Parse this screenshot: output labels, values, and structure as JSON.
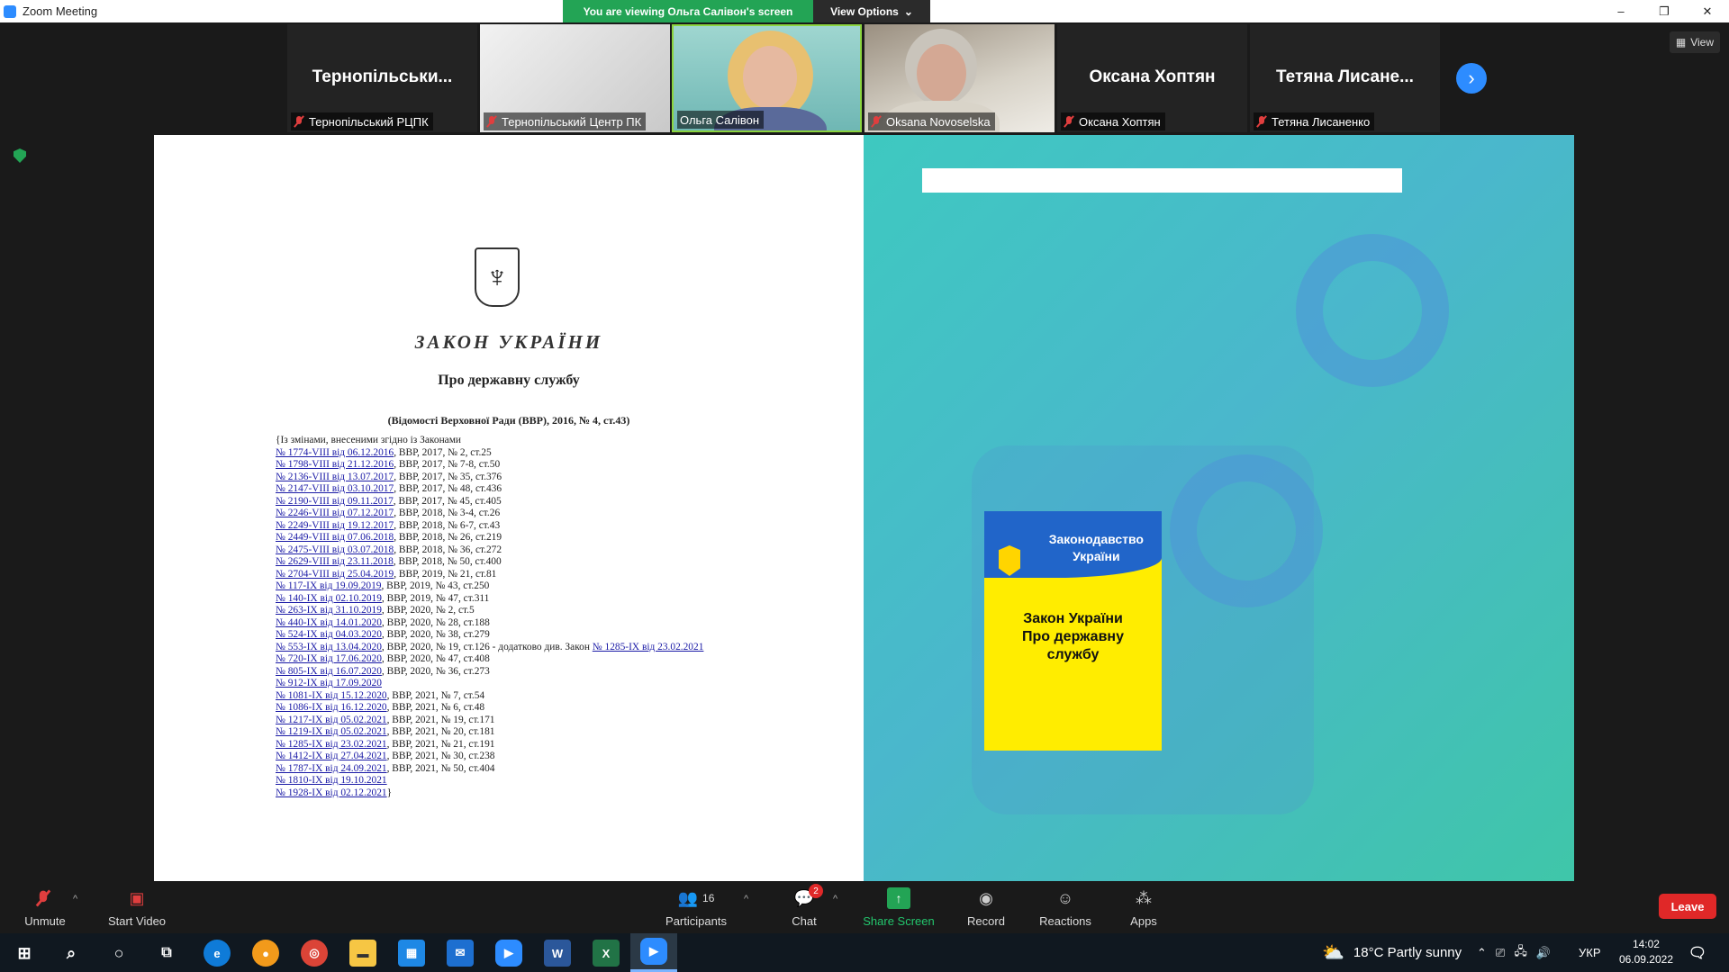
{
  "window": {
    "title": "Zoom Meeting",
    "banner": "You are viewing Ольга Салівон's screen",
    "view_options": "View Options",
    "controls": [
      "–",
      "❐",
      "✕"
    ]
  },
  "strip": {
    "tiles": [
      {
        "big_name": "Тернопільськи...",
        "label": "Тернопільський РЦПК"
      },
      {
        "big_name": "",
        "label": "Тернопільський Центр ПК"
      },
      {
        "big_name": "",
        "label": "Ольга Салівон"
      },
      {
        "big_name": "",
        "label": "Oksana Novoselska"
      },
      {
        "big_name": "Оксана Хоптян",
        "label": "Оксана Хоптян"
      },
      {
        "big_name": "Тетяна  Лисане...",
        "label": "Тетяна Лисаненко"
      }
    ],
    "view_label": "View"
  },
  "document": {
    "title": "ЗАКОН УКРАЇНИ",
    "subtitle": "Про державну службу",
    "source": "(Відомості Верховної Ради (ВВР), 2016, № 4, ст.43)",
    "intro": "{Із змінами, внесеними згідно із Законами",
    "amendments": [
      {
        "link": "№ 1774-VIII від 06.12.2016",
        "ref": ", ВВР, 2017, № 2, ст.25"
      },
      {
        "link": "№ 1798-VIII від 21.12.2016",
        "ref": ", ВВР, 2017, № 7-8, ст.50"
      },
      {
        "link": "№ 2136-VIII від 13.07.2017",
        "ref": ", ВВР, 2017, № 35, ст.376"
      },
      {
        "link": "№ 2147-VIII від 03.10.2017",
        "ref": ", ВВР, 2017, № 48, ст.436"
      },
      {
        "link": "№ 2190-VIII від 09.11.2017",
        "ref": ", ВВР, 2017, № 45, ст.405"
      },
      {
        "link": "№ 2246-VIII від 07.12.2017",
        "ref": ", ВВР, 2018, № 3-4, ст.26"
      },
      {
        "link": "№ 2249-VIII від 19.12.2017",
        "ref": ", ВВР, 2018, № 6-7, ст.43"
      },
      {
        "link": "№ 2449-VIII від 07.06.2018",
        "ref": ", ВВР, 2018, № 26, ст.219"
      },
      {
        "link": "№ 2475-VIII від 03.07.2018",
        "ref": ", ВВР, 2018, № 36, ст.272"
      },
      {
        "link": "№ 2629-VIII від 23.11.2018",
        "ref": ", ВВР, 2018, № 50, ст.400"
      },
      {
        "link": "№ 2704-VIII від 25.04.2019",
        "ref": ", ВВР, 2019, № 21, ст.81"
      },
      {
        "link": "№ 117-IX від 19.09.2019",
        "ref": ", ВВР, 2019, № 43, ст.250"
      },
      {
        "link": "№ 140-IX від 02.10.2019",
        "ref": ", ВВР, 2019, № 47, ст.311"
      },
      {
        "link": "№ 263-IX від 31.10.2019",
        "ref": ", ВВР, 2020, № 2, ст.5"
      },
      {
        "link": "№ 440-IX від 14.01.2020",
        "ref": ", ВВР, 2020, № 28, ст.188"
      },
      {
        "link": "№ 524-IX від 04.03.2020",
        "ref": ", ВВР, 2020, № 38, ст.279"
      },
      {
        "link": "№ 553-IX від 13.04.2020",
        "ref": ", ВВР, 2020, № 19, ст.126 - додатково див. Закон ",
        "link2": "№ 1285-IX від 23.02.2021"
      },
      {
        "link": "№ 720-IX від 17.06.2020",
        "ref": ", ВВР, 2020, № 47, ст.408"
      },
      {
        "link": "№ 805-IX від 16.07.2020",
        "ref": ", ВВР, 2020, № 36, ст.273"
      },
      {
        "link": "№ 912-IX від 17.09.2020",
        "ref": ""
      },
      {
        "link": "№ 1081-IX від 15.12.2020",
        "ref": ", ВВР, 2021, № 7, ст.54"
      },
      {
        "link": "№ 1086-IX від 16.12.2020",
        "ref": ", ВВР, 2021, № 6, ст.48"
      },
      {
        "link": "№ 1217-IX від 05.02.2021",
        "ref": ", ВВР, 2021, № 19, ст.171"
      },
      {
        "link": "№ 1219-IX від 05.02.2021",
        "ref": ", ВВР, 2021, № 20, ст.181"
      },
      {
        "link": "№ 1285-IX від 23.02.2021",
        "ref": ", ВВР, 2021, № 21, ст.191"
      },
      {
        "link": "№ 1412-IX від 27.04.2021",
        "ref": ", ВВР, 2021, № 30, ст.238"
      },
      {
        "link": "№ 1787-IX від 24.09.2021",
        "ref": ", ВВР, 2021, № 50, ст.404"
      },
      {
        "link": "№ 1810-IX від 19.10.2021",
        "ref": ""
      },
      {
        "link": "№ 1928-IX від 02.12.2021",
        "ref": "}"
      }
    ]
  },
  "slide": {
    "book_header": "Законодавство\nУкраїни",
    "book_title": "Закон України\nПро державну\nслужбу"
  },
  "toolbar": {
    "unmute": "Unmute",
    "start_video": "Start Video",
    "participants": "Participants",
    "participants_count": "16",
    "chat": "Chat",
    "chat_badge": "2",
    "share_screen": "Share Screen",
    "record": "Record",
    "reactions": "Reactions",
    "apps": "Apps",
    "leave": "Leave"
  },
  "taskbar": {
    "weather": "18°C  Partly sunny",
    "lang": "УКР",
    "time": "14:02",
    "date": "06.09.2022"
  },
  "colors": {
    "accent": "#2D8CFF",
    "green": "#23a455",
    "danger": "#e02828",
    "book_blue": "#2165c9",
    "book_yellow": "#ffed00"
  }
}
